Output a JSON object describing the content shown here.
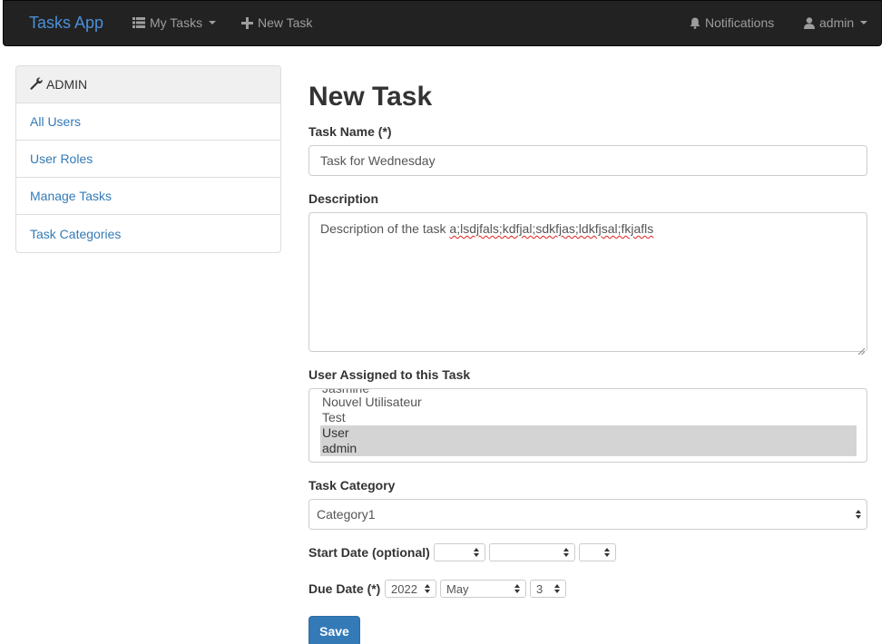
{
  "navbar": {
    "brand": "Tasks App",
    "my_tasks": "My Tasks",
    "new_task": "New Task",
    "notifications": "Notifications",
    "user": "admin"
  },
  "sidebar": {
    "header": "ADMIN",
    "items": [
      {
        "label": "All Users"
      },
      {
        "label": "User Roles"
      },
      {
        "label": "Manage Tasks"
      },
      {
        "label": "Task Categories"
      }
    ]
  },
  "form": {
    "title": "New Task",
    "task_name_label": "Task Name (*)",
    "task_name_value": "Task for Wednesday",
    "description_label": "Description",
    "description_prefix": "Description of the task ",
    "description_misspelled": "a;lsdjfals;kdfjal;sdkfjas;ldkfjsal;fkjafls",
    "user_label": "User Assigned to this Task",
    "user_options": [
      {
        "label": "Jasmine",
        "selected": false
      },
      {
        "label": "Nouvel Utilisateur",
        "selected": false
      },
      {
        "label": "Test",
        "selected": false
      },
      {
        "label": "User",
        "selected": true
      },
      {
        "label": "admin",
        "selected": true
      }
    ],
    "category_label": "Task Category",
    "category_value": "Category1",
    "start_date_label": "Start Date (optional)",
    "start_year": "",
    "start_month": "",
    "start_day": "",
    "due_date_label": "Due Date (*)",
    "due_year": "2022",
    "due_month": "May",
    "due_day": "3",
    "save_label": "Save"
  }
}
